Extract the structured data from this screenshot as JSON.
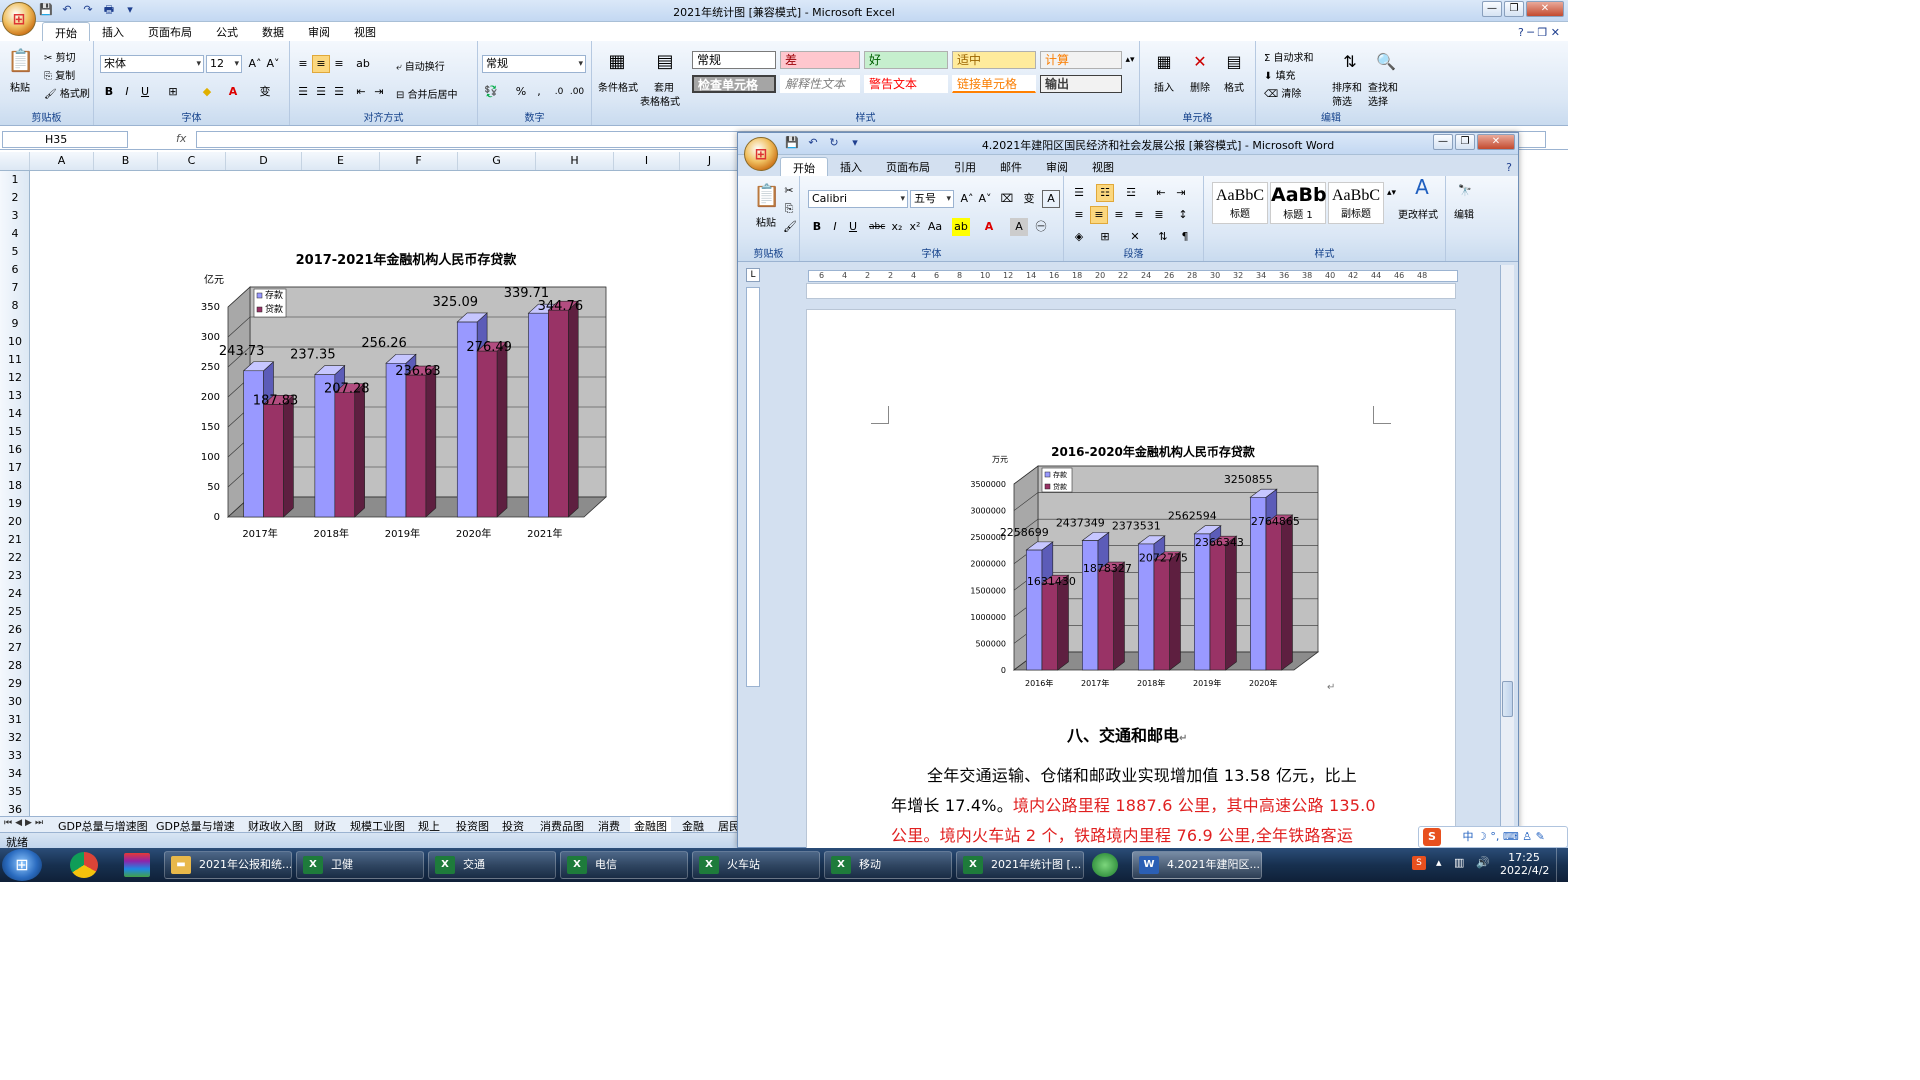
{
  "excel": {
    "title": "2021年统计图  [兼容模式] - Microsoft Excel",
    "tabs": [
      "开始",
      "插入",
      "页面布局",
      "公式",
      "数据",
      "审阅",
      "视图"
    ],
    "clipboard": {
      "paste": "粘贴",
      "cut": "剪切",
      "copy": "复制",
      "format_painter": "格式刷",
      "label": "剪贴板"
    },
    "font": {
      "name": "宋体",
      "size": "12",
      "label": "字体"
    },
    "alignment": {
      "wrap": "自动换行",
      "merge": "合并后居中",
      "label": "对齐方式"
    },
    "number": {
      "format": "常规",
      "label": "数字"
    },
    "styles": {
      "conditional": "条件格式",
      "table_format_1": "套用",
      "table_format_2": "表格格式",
      "items": [
        "常规",
        "差",
        "好",
        "适中",
        "计算",
        "检查单元格",
        "解释性文本",
        "警告文本",
        "链接单元格",
        "输出"
      ],
      "label": "样式"
    },
    "cells": {
      "insert": "插入",
      "delete": "删除",
      "format": "格式",
      "label": "单元格"
    },
    "editing": {
      "autosum": "自动求和",
      "fill": "填充",
      "clear": "清除",
      "sort_1": "排序和",
      "sort_2": "筛选",
      "find_1": "查找和",
      "find_2": "选择",
      "label": "编辑"
    },
    "name_box": "H35",
    "fx": "fx",
    "columns": [
      "A",
      "B",
      "C",
      "D",
      "E",
      "F",
      "G",
      "H",
      "I",
      "J"
    ],
    "rows": [
      "1",
      "2",
      "3",
      "4",
      "5",
      "6",
      "7",
      "8",
      "9",
      "10",
      "11",
      "12",
      "13",
      "14",
      "15",
      "16",
      "17",
      "18",
      "19",
      "20",
      "21",
      "22",
      "23",
      "24",
      "25",
      "26",
      "27",
      "28",
      "29",
      "30",
      "31",
      "32",
      "33",
      "34",
      "35",
      "36"
    ],
    "sheet_tabs": [
      "GDP总量与增速图",
      "GDP总量与增速",
      "财政收入图",
      "财政",
      "规模工业图",
      "规上",
      "投资图",
      "投资",
      "消费品图",
      "消费",
      "金融图",
      "金融",
      "居民"
    ],
    "status": "就绪"
  },
  "word": {
    "title": "4.2021年建阳区国民经济和社会发展公报 [兼容模式] - Microsoft Word",
    "tabs": [
      "开始",
      "插入",
      "页面布局",
      "引用",
      "邮件",
      "审阅",
      "视图"
    ],
    "clipboard": {
      "paste": "粘贴",
      "label": "剪贴板"
    },
    "font": {
      "name": "Calibri",
      "size": "五号",
      "label": "字体"
    },
    "paragraph_label": "段落",
    "styles": [
      {
        "preview": "AaBbC",
        "name": "标题"
      },
      {
        "preview": "AaBb",
        "name": "标题 1"
      },
      {
        "preview": "AaBbC",
        "name": "副标题"
      }
    ],
    "styles_label": "样式",
    "change_styles": "更改样式",
    "edit": "编辑",
    "ruler": [
      "6",
      "4",
      "2",
      "2",
      "4",
      "6",
      "8",
      "10",
      "12",
      "14",
      "16",
      "18",
      "20",
      "22",
      "24",
      "26",
      "28",
      "30",
      "32",
      "34",
      "36",
      "38",
      "40",
      "42",
      "44",
      "46",
      "48"
    ],
    "heading": "八、交通和邮电",
    "para": [
      {
        "text": "全年交通运输、仓储和邮政业实现增加值 13.58 亿元，比上",
        "color": "black"
      },
      {
        "text": "年增长 17.4%。",
        "color": "black"
      },
      {
        "text": "境内公路里程 1887.6 公里，其中高速公路 135.0",
        "color": "red"
      },
      {
        "text": "公里。境内火车站 2 个，铁路境内里程 76.9 公里,全年铁路客运",
        "color": "red"
      }
    ],
    "para_mark": "↵"
  },
  "taskbar": {
    "items": [
      "2021年公报和统...",
      "卫健",
      "交通",
      "电信",
      "火车站",
      "移动",
      "2021年统计图 [...",
      "4.2021年建阳区..."
    ],
    "time": "17:25",
    "date": "2022/4/2",
    "ime": "中"
  },
  "chart_data": [
    {
      "type": "bar",
      "title": "2017-2021年金融机构人民币存贷款",
      "unit": "亿元",
      "categories": [
        "2017年",
        "2018年",
        "2019年",
        "2020年",
        "2021年"
      ],
      "series": [
        {
          "name": "存款",
          "values": [
            243.73,
            237.35,
            256.26,
            325.09,
            339.71
          ],
          "labels": [
            "243.73",
            "237.35",
            "256.26",
            "325.09",
            "339.71"
          ],
          "color": "#9999ff"
        },
        {
          "name": "贷款",
          "values": [
            187.83,
            207.28,
            236.63,
            276.49,
            344.76
          ],
          "labels": [
            "187.83",
            "207.28",
            "236.63",
            "276.49",
            "344.76"
          ],
          "color": "#993366"
        }
      ],
      "ylim": [
        0,
        350
      ],
      "yticks": [
        "0",
        "50",
        "100",
        "150",
        "200",
        "250",
        "300",
        "350"
      ]
    },
    {
      "type": "bar",
      "title": "2016-2020年金融机构人民币存贷款",
      "unit": "万元",
      "categories": [
        "2016年",
        "2017年",
        "2018年",
        "2019年",
        "2020年"
      ],
      "series": [
        {
          "name": "存款",
          "values": [
            2258699,
            2437349,
            2373531,
            2562594,
            3250855
          ],
          "labels": [
            "2258699",
            "2437349",
            "2373531",
            "2562594",
            "3250855"
          ],
          "color": "#9999ff"
        },
        {
          "name": "贷款",
          "values": [
            1631430,
            1878327,
            2072775,
            2366343,
            2764865
          ],
          "labels": [
            "1631430",
            "1878327",
            "2072775",
            "2366343",
            "2764865"
          ],
          "color": "#993366"
        }
      ],
      "ylim": [
        0,
        3500000
      ],
      "yticks": [
        "0",
        "500000",
        "1000000",
        "1500000",
        "2000000",
        "2500000",
        "3000000",
        "3500000"
      ]
    }
  ]
}
